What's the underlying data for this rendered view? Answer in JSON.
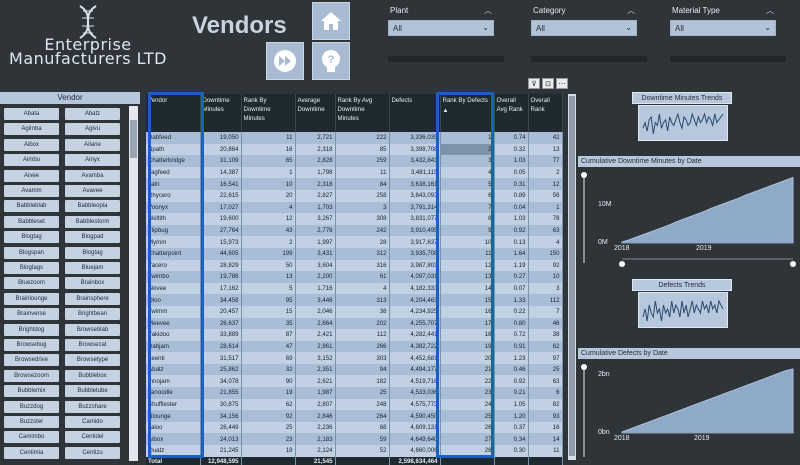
{
  "header": {
    "company_line1": "Enterprise",
    "company_line2": "Manufacturers LTD",
    "title": "Vendors"
  },
  "filters": [
    {
      "label": "Plant",
      "value": "All"
    },
    {
      "label": "Category",
      "value": "All"
    },
    {
      "label": "Material Type",
      "value": "All"
    }
  ],
  "vendor_slicer": {
    "title": "Vendor",
    "items": [
      "Abata",
      "Abatz",
      "Agimba",
      "Agivu",
      "Aibox",
      "Ailane",
      "Aimbu",
      "Ainyx",
      "Aivee",
      "Avamba",
      "Avamm",
      "Avavee",
      "Babbleblab",
      "Babbleopia",
      "Babbleset",
      "Babblestorm",
      "Blogtag",
      "Blogpad",
      "Blogspan",
      "Blogtag",
      "Blogtags",
      "Bluejam",
      "Bluezoom",
      "Brainbox",
      "Brainlounge",
      "Brainsphere",
      "Brainverse",
      "Brightbean",
      "Brightdog",
      "Browseblab",
      "Browsebug",
      "Browsecat",
      "Browsedrive",
      "Browsetype",
      "Browsezoom",
      "Bubblebox",
      "Bubblemix",
      "Bubbletube",
      "Buzzdog",
      "Buzzshare",
      "Buzzster",
      "Camido",
      "Camimbo",
      "Centidel",
      "Centimia",
      "Centizu"
    ]
  },
  "table": {
    "columns": [
      "Vendor",
      "Downtime Minutes",
      "Rank By Downtime Minutes",
      "Average Downtime",
      "Rank By Avg Downtime Minutes",
      "Defects",
      "Rank By Defects",
      "Overall Avg Rank",
      "Overall Rank"
    ],
    "sort_indicator": "▲",
    "rows": [
      [
        "Dabfeed",
        "19,050",
        "11",
        "2,721",
        "222",
        "3,336,035",
        "1",
        "0.74",
        "42"
      ],
      [
        "Npath",
        "20,864",
        "16",
        "2,318",
        "85",
        "3,398,708",
        "2",
        "0.32",
        "13"
      ],
      [
        "Chatterbridge",
        "31,109",
        "65",
        "2,828",
        "259",
        "3,432,843",
        "3",
        "1.03",
        "77"
      ],
      [
        "Tagfeed",
        "14,387",
        "1",
        "1,798",
        "11",
        "3,481,115",
        "4",
        "0.05",
        "2"
      ],
      [
        "Jatri",
        "16,541",
        "10",
        "2,318",
        "84",
        "3,638,161",
        "5",
        "0.31",
        "12"
      ],
      [
        "Rhycero",
        "22,615",
        "20",
        "2,827",
        "258",
        "3,643,093",
        "6",
        "0.89",
        "56"
      ],
      [
        "Voonyx",
        "17,027",
        "4",
        "1,703",
        "3",
        "3,791,314",
        "7",
        "0.04",
        "1"
      ],
      [
        "Skiltith",
        "19,600",
        "12",
        "3,267",
        "308",
        "3,831,077",
        "8",
        "1.03",
        "78"
      ],
      [
        "Flipbug",
        "27,764",
        "43",
        "2,776",
        "242",
        "3,910,495",
        "9",
        "0.92",
        "63"
      ],
      [
        "Mymm",
        "15,973",
        "2",
        "1,997",
        "28",
        "3,917,637",
        "10",
        "0.13",
        "4"
      ],
      [
        "Chatterpoint",
        "44,605",
        "199",
        "3,431",
        "312",
        "3,935,708",
        "11",
        "1.64",
        "150"
      ],
      [
        "Yacero",
        "28,829",
        "50",
        "3,604",
        "316",
        "3,987,803",
        "12",
        "1.19",
        "92"
      ],
      [
        "Twimbo",
        "19,786",
        "13",
        "2,200",
        "61",
        "4,097,031",
        "13",
        "0.27",
        "10"
      ],
      [
        "Skivee",
        "17,162",
        "5",
        "1,716",
        "4",
        "4,182,333",
        "14",
        "0.07",
        "3"
      ],
      [
        "Oloo",
        "34,458",
        "95",
        "3,446",
        "313",
        "4,204,463",
        "15",
        "1.33",
        "112"
      ],
      [
        "Twimm",
        "20,457",
        "15",
        "2,046",
        "38",
        "4,234,925",
        "16",
        "0.22",
        "7"
      ],
      [
        "Meevee",
        "26,637",
        "35",
        "2,664",
        "202",
        "4,255,707",
        "17",
        "0.80",
        "46"
      ],
      [
        "Yakidoo",
        "33,889",
        "87",
        "2,421",
        "112",
        "4,282,441",
        "18",
        "0.72",
        "38"
      ],
      [
        "Dabjam",
        "28,614",
        "47",
        "2,861",
        "266",
        "4,382,722",
        "19",
        "0.91",
        "62"
      ],
      [
        "Leenti",
        "31,517",
        "69",
        "3,152",
        "303",
        "4,452,681",
        "20",
        "1.23",
        "97"
      ],
      [
        "Abatz",
        "25,862",
        "32",
        "2,351",
        "94",
        "4,494,177",
        "21",
        "0.46",
        "25"
      ],
      [
        "Innojam",
        "34,078",
        "90",
        "2,621",
        "182",
        "4,519,716",
        "22",
        "0.92",
        "63"
      ],
      [
        "Tanoodle",
        "21,855",
        "19",
        "1,987",
        "25",
        "4,533,036",
        "23",
        "0.21",
        "6"
      ],
      [
        "Shufflester",
        "30,875",
        "62",
        "2,807",
        "248",
        "4,575,773",
        "24",
        "1.05",
        "82"
      ],
      [
        "Nlounge",
        "34,156",
        "92",
        "2,846",
        "264",
        "4,590,450",
        "25",
        "1.20",
        "93"
      ],
      [
        "Jaloo",
        "26,449",
        "25",
        "2,236",
        "68",
        "4,609,131",
        "26",
        "0.37",
        "16"
      ],
      [
        "Aibox",
        "24,013",
        "23",
        "2,183",
        "59",
        "4,649,640",
        "27",
        "0.34",
        "14"
      ],
      [
        "Quatz",
        "21,245",
        "18",
        "2,124",
        "52",
        "4,660,006",
        "28",
        "0.30",
        "11"
      ]
    ],
    "total": [
      "Total",
      "12,948,595",
      "",
      "21,545",
      "",
      "2,598,634,464",
      "",
      "",
      ""
    ]
  },
  "panels": {
    "downtime_trend_title": "Downtime Minutes Trends",
    "defects_trend_title": "Defects Trends",
    "cum_downtime_title": "Cumulative Downtime Minutes by Date",
    "cum_defects_title": "Cumulative Defects by Date"
  },
  "chart_data": [
    {
      "type": "area",
      "title": "Cumulative Downtime Minutes by Date",
      "x_ticks": [
        "2018",
        "2019"
      ],
      "y_ticks": [
        "0M",
        "10M"
      ],
      "ylim": [
        0,
        13000000
      ],
      "values": [
        0.2,
        0.6,
        1.1,
        1.6,
        2.1,
        2.6,
        3.1,
        3.6,
        4.2,
        4.7,
        5.2,
        5.7,
        6.2,
        6.8,
        7.3,
        7.8,
        8.3,
        8.8,
        9.4,
        9.9,
        10.4,
        10.9,
        11.4,
        11.9,
        12.4,
        12.9
      ]
    },
    {
      "type": "area",
      "title": "Cumulative Defects by Date",
      "x_ticks": [
        "2018",
        "2019"
      ],
      "y_ticks": [
        "0bn",
        "2bn"
      ],
      "ylim": [
        0,
        2600000000
      ],
      "values": [
        0.04,
        0.14,
        0.24,
        0.34,
        0.44,
        0.54,
        0.64,
        0.74,
        0.84,
        0.94,
        1.04,
        1.14,
        1.24,
        1.34,
        1.44,
        1.54,
        1.64,
        1.74,
        1.84,
        1.94,
        2.04,
        2.14,
        2.24,
        2.34,
        2.44,
        2.54,
        2.6
      ]
    },
    {
      "type": "line",
      "title": "Downtime Minutes Trends",
      "values": [
        4,
        6,
        3,
        7,
        8,
        2,
        6,
        5,
        9,
        4,
        6,
        7,
        3,
        8,
        6,
        5,
        7,
        9,
        6,
        4,
        8,
        7,
        5,
        6,
        9,
        7,
        5,
        8,
        6,
        7,
        9,
        6,
        8,
        7,
        5,
        9,
        6,
        7,
        8,
        9
      ]
    },
    {
      "type": "line",
      "title": "Defects Trends",
      "values": [
        5,
        7,
        4,
        8,
        6,
        5,
        9,
        6,
        7,
        4,
        8,
        6,
        7,
        5,
        9,
        6,
        8,
        7,
        5,
        9,
        6,
        8,
        5,
        7,
        9,
        6,
        8,
        7,
        6,
        9,
        7,
        8,
        6,
        9,
        7,
        8,
        6,
        9,
        8,
        7
      ]
    }
  ],
  "colors": {
    "background": "#2f3438",
    "accent_blue": "#1a5fc2",
    "chip": "#c4d2e2",
    "area_fill": "#8faac8"
  }
}
